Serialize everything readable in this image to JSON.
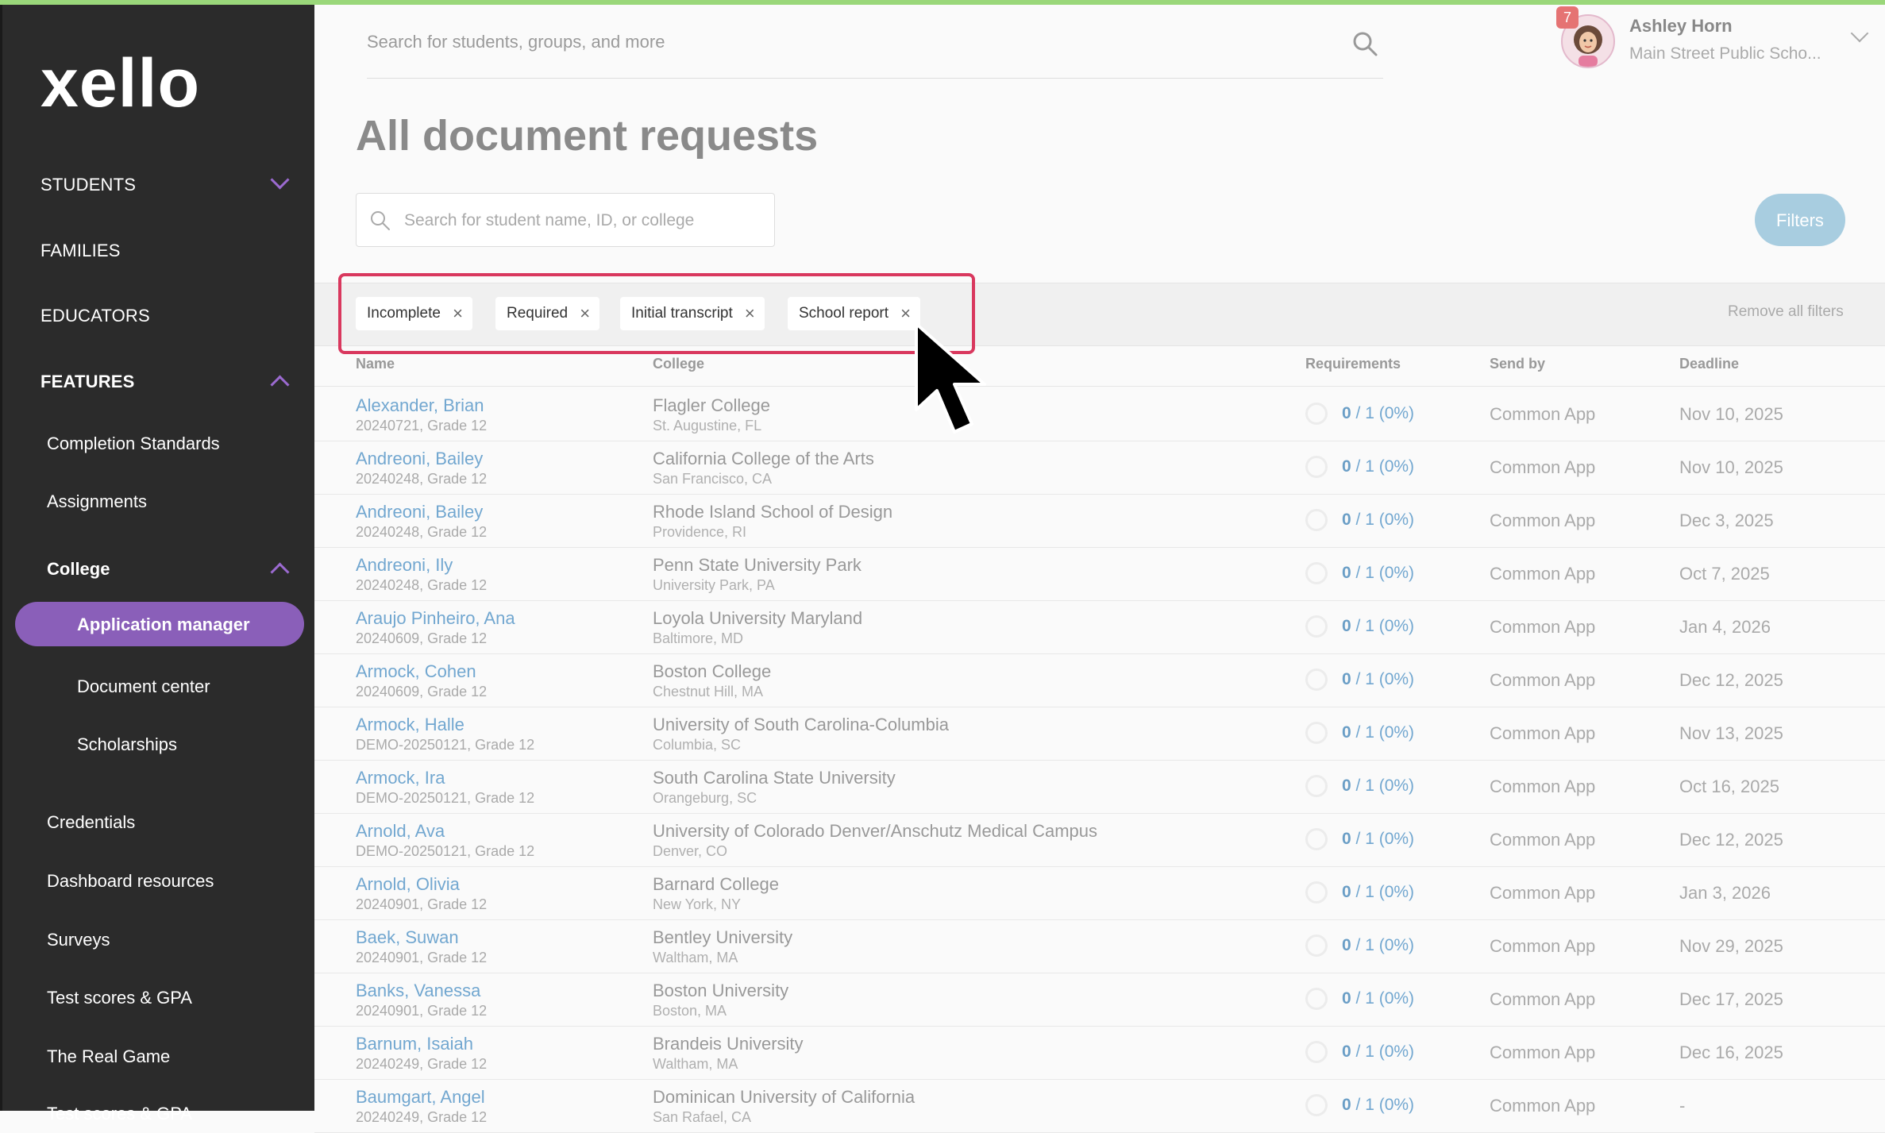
{
  "app": {
    "logo_text": "xello",
    "accent": "#8a5fb9"
  },
  "sidebar": {
    "students": "STUDENTS",
    "families": "FAMILIES",
    "educators": "EDUCATORS",
    "features": "FEATURES",
    "completion_standards": "Completion Standards",
    "assignments": "Assignments",
    "college": "College",
    "application_manager": "Application manager",
    "document_center": "Document center",
    "scholarships": "Scholarships",
    "credentials": "Credentials",
    "dashboard_resources": "Dashboard resources",
    "surveys": "Surveys",
    "test_scores": "Test scores & GPA",
    "real_game": "The Real Game",
    "test_scores_2": "Test scores & GPA"
  },
  "header": {
    "search_placeholder": "Search for students, groups, and more",
    "user_name": "Ashley Horn",
    "user_school": "Main Street Public Scho...",
    "notification_count": "7"
  },
  "page": {
    "title": "All document requests",
    "search_placeholder": "Search for student name, ID, or college",
    "filters_label": "Filters",
    "remove_all": "Remove all filters",
    "chips": [
      "Incomplete",
      "Required",
      "Initial transcript",
      "School report"
    ]
  },
  "table": {
    "headers": {
      "name": "Name",
      "college": "College",
      "requirements": "Requirements",
      "send_by": "Send by",
      "deadline": "Deadline"
    },
    "rows": [
      {
        "name": "Alexander, Brian",
        "id": "20240721, Grade 12",
        "college": "Flagler College",
        "location": "St. Augustine, FL",
        "req_num": "0",
        "req_rest": " / 1 (0%)",
        "send_by": "Common App",
        "deadline": "Nov 10, 2025"
      },
      {
        "name": "Andreoni, Bailey",
        "id": "20240248, Grade 12",
        "college": "California College of the Arts",
        "location": "San Francisco, CA",
        "req_num": "0",
        "req_rest": " / 1 (0%)",
        "send_by": "Common App",
        "deadline": "Nov 10, 2025"
      },
      {
        "name": "Andreoni, Bailey",
        "id": "20240248, Grade 12",
        "college": "Rhode Island School of Design",
        "location": "Providence, RI",
        "req_num": "0",
        "req_rest": " / 1 (0%)",
        "send_by": "Common App",
        "deadline": "Dec 3, 2025"
      },
      {
        "name": "Andreoni, Ily",
        "id": "20240248, Grade 12",
        "college": "Penn State University Park",
        "location": "University Park, PA",
        "req_num": "0",
        "req_rest": " / 1 (0%)",
        "send_by": "Common App",
        "deadline": "Oct 7, 2025"
      },
      {
        "name": "Araujo Pinheiro, Ana",
        "id": "20240609, Grade 12",
        "college": "Loyola University Maryland",
        "location": "Baltimore, MD",
        "req_num": "0",
        "req_rest": " / 1 (0%)",
        "send_by": "Common App",
        "deadline": "Jan 4, 2026"
      },
      {
        "name": "Armock, Cohen",
        "id": "20240609, Grade 12",
        "college": "Boston College",
        "location": "Chestnut Hill, MA",
        "req_num": "0",
        "req_rest": " / 1 (0%)",
        "send_by": "Common App",
        "deadline": "Dec 12, 2025"
      },
      {
        "name": "Armock, Halle",
        "id": "DEMO-20250121, Grade 12",
        "college": "University of South Carolina-Columbia",
        "location": "Columbia, SC",
        "req_num": "0",
        "req_rest": " / 1 (0%)",
        "send_by": "Common App",
        "deadline": "Nov 13, 2025"
      },
      {
        "name": "Armock, Ira",
        "id": "DEMO-20250121, Grade 12",
        "college": "South Carolina State University",
        "location": "Orangeburg, SC",
        "req_num": "0",
        "req_rest": " / 1 (0%)",
        "send_by": "Common App",
        "deadline": "Oct 16, 2025"
      },
      {
        "name": "Arnold, Ava",
        "id": "DEMO-20250121, Grade 12",
        "college": "University of Colorado Denver/Anschutz Medical Campus",
        "location": "Denver, CO",
        "req_num": "0",
        "req_rest": " / 1 (0%)",
        "send_by": "Common App",
        "deadline": "Dec 12, 2025"
      },
      {
        "name": "Arnold, Olivia",
        "id": "20240901, Grade 12",
        "college": "Barnard College",
        "location": "New York, NY",
        "req_num": "0",
        "req_rest": " / 1 (0%)",
        "send_by": "Common App",
        "deadline": "Jan 3, 2026"
      },
      {
        "name": "Baek, Suwan",
        "id": "20240901, Grade 12",
        "college": "Bentley University",
        "location": "Waltham, MA",
        "req_num": "0",
        "req_rest": " / 1 (0%)",
        "send_by": "Common App",
        "deadline": "Nov 29, 2025"
      },
      {
        "name": "Banks, Vanessa",
        "id": "20240901, Grade 12",
        "college": "Boston University",
        "location": "Boston, MA",
        "req_num": "0",
        "req_rest": " / 1 (0%)",
        "send_by": "Common App",
        "deadline": "Dec 17, 2025"
      },
      {
        "name": "Barnum, Isaiah",
        "id": "20240249, Grade 12",
        "college": "Brandeis University",
        "location": "Waltham, MA",
        "req_num": "0",
        "req_rest": " / 1 (0%)",
        "send_by": "Common App",
        "deadline": "Dec 16, 2025"
      },
      {
        "name": "Baumgart, Angel",
        "id": "20240249, Grade 12",
        "college": "Dominican University of California",
        "location": "San Rafael, CA",
        "req_num": "0",
        "req_rest": " / 1 (0%)",
        "send_by": "Common App",
        "deadline": "-"
      }
    ]
  }
}
